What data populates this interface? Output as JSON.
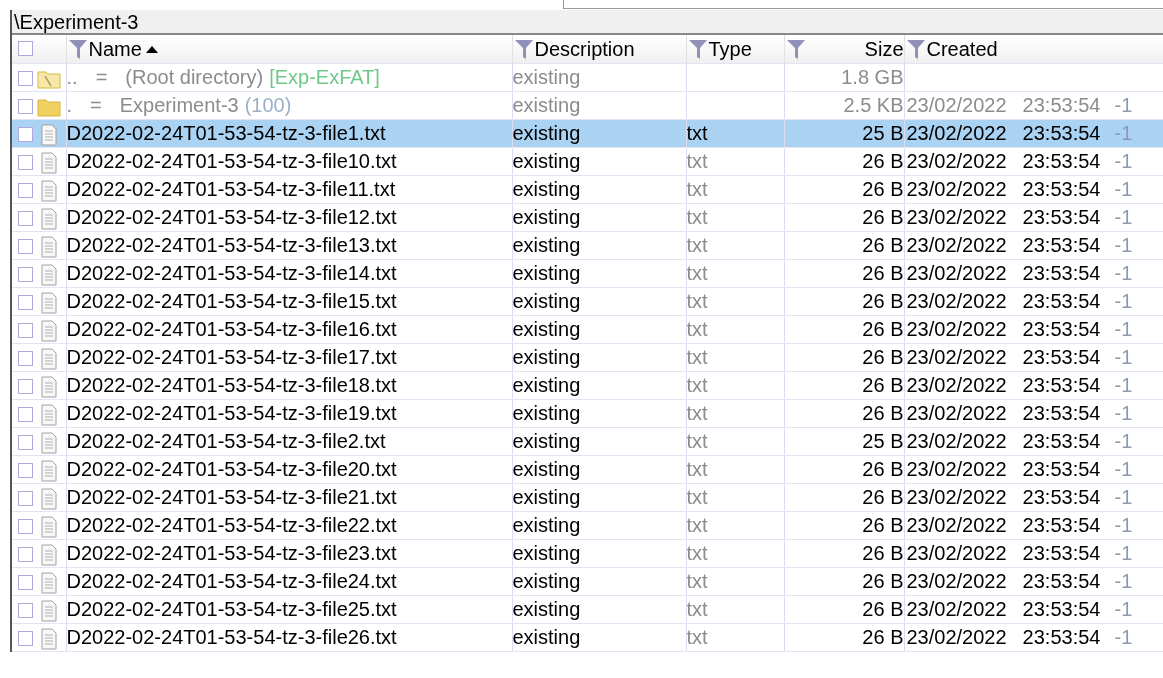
{
  "path": "\\Experiment-3",
  "header_checked": false,
  "columns": [
    {
      "label": "Name",
      "sorted": true
    },
    {
      "label": "Description",
      "sorted": false
    },
    {
      "label": "Type",
      "sorted": false
    },
    {
      "label": "Size",
      "sorted": false
    },
    {
      "label": "Created",
      "sorted": false
    }
  ],
  "rows": [
    {
      "kind": "parent",
      "selected": false,
      "checked": false,
      "name": "..",
      "sign": "=",
      "label": "(Root directory)",
      "extra": "[Exp-ExFAT]",
      "description": "existing",
      "size": "1.8 GB"
    },
    {
      "kind": "current",
      "selected": false,
      "checked": false,
      "name": ".",
      "sign": "=",
      "label": "Experiment-3",
      "extra": "(100)",
      "description": "existing",
      "size": "2.5 KB",
      "date": "23/02/2022",
      "time": "23:53:54",
      "tail": "-1"
    },
    {
      "kind": "file",
      "selected": true,
      "checked": false,
      "name": "D2022-02-24T01-53-54-tz-3-file1.txt",
      "description": "existing",
      "type": "txt",
      "size": "25 B",
      "date": "23/02/2022",
      "time": "23:53:54",
      "tail": "-1"
    },
    {
      "kind": "file",
      "selected": false,
      "checked": false,
      "name": "D2022-02-24T01-53-54-tz-3-file10.txt",
      "description": "existing",
      "type": "txt",
      "size": "26 B",
      "date": "23/02/2022",
      "time": "23:53:54",
      "tail": "-1"
    },
    {
      "kind": "file",
      "selected": false,
      "checked": false,
      "name": "D2022-02-24T01-53-54-tz-3-file11.txt",
      "description": "existing",
      "type": "txt",
      "size": "26 B",
      "date": "23/02/2022",
      "time": "23:53:54",
      "tail": "-1"
    },
    {
      "kind": "file",
      "selected": false,
      "checked": false,
      "name": "D2022-02-24T01-53-54-tz-3-file12.txt",
      "description": "existing",
      "type": "txt",
      "size": "26 B",
      "date": "23/02/2022",
      "time": "23:53:54",
      "tail": "-1"
    },
    {
      "kind": "file",
      "selected": false,
      "checked": false,
      "name": "D2022-02-24T01-53-54-tz-3-file13.txt",
      "description": "existing",
      "type": "txt",
      "size": "26 B",
      "date": "23/02/2022",
      "time": "23:53:54",
      "tail": "-1"
    },
    {
      "kind": "file",
      "selected": false,
      "checked": false,
      "name": "D2022-02-24T01-53-54-tz-3-file14.txt",
      "description": "existing",
      "type": "txt",
      "size": "26 B",
      "date": "23/02/2022",
      "time": "23:53:54",
      "tail": "-1"
    },
    {
      "kind": "file",
      "selected": false,
      "checked": false,
      "name": "D2022-02-24T01-53-54-tz-3-file15.txt",
      "description": "existing",
      "type": "txt",
      "size": "26 B",
      "date": "23/02/2022",
      "time": "23:53:54",
      "tail": "-1"
    },
    {
      "kind": "file",
      "selected": false,
      "checked": false,
      "name": "D2022-02-24T01-53-54-tz-3-file16.txt",
      "description": "existing",
      "type": "txt",
      "size": "26 B",
      "date": "23/02/2022",
      "time": "23:53:54",
      "tail": "-1"
    },
    {
      "kind": "file",
      "selected": false,
      "checked": false,
      "name": "D2022-02-24T01-53-54-tz-3-file17.txt",
      "description": "existing",
      "type": "txt",
      "size": "26 B",
      "date": "23/02/2022",
      "time": "23:53:54",
      "tail": "-1"
    },
    {
      "kind": "file",
      "selected": false,
      "checked": false,
      "name": "D2022-02-24T01-53-54-tz-3-file18.txt",
      "description": "existing",
      "type": "txt",
      "size": "26 B",
      "date": "23/02/2022",
      "time": "23:53:54",
      "tail": "-1"
    },
    {
      "kind": "file",
      "selected": false,
      "checked": false,
      "name": "D2022-02-24T01-53-54-tz-3-file19.txt",
      "description": "existing",
      "type": "txt",
      "size": "26 B",
      "date": "23/02/2022",
      "time": "23:53:54",
      "tail": "-1"
    },
    {
      "kind": "file",
      "selected": false,
      "checked": false,
      "name": "D2022-02-24T01-53-54-tz-3-file2.txt",
      "description": "existing",
      "type": "txt",
      "size": "25 B",
      "date": "23/02/2022",
      "time": "23:53:54",
      "tail": "-1"
    },
    {
      "kind": "file",
      "selected": false,
      "checked": false,
      "name": "D2022-02-24T01-53-54-tz-3-file20.txt",
      "description": "existing",
      "type": "txt",
      "size": "26 B",
      "date": "23/02/2022",
      "time": "23:53:54",
      "tail": "-1"
    },
    {
      "kind": "file",
      "selected": false,
      "checked": false,
      "name": "D2022-02-24T01-53-54-tz-3-file21.txt",
      "description": "existing",
      "type": "txt",
      "size": "26 B",
      "date": "23/02/2022",
      "time": "23:53:54",
      "tail": "-1"
    },
    {
      "kind": "file",
      "selected": false,
      "checked": false,
      "name": "D2022-02-24T01-53-54-tz-3-file22.txt",
      "description": "existing",
      "type": "txt",
      "size": "26 B",
      "date": "23/02/2022",
      "time": "23:53:54",
      "tail": "-1"
    },
    {
      "kind": "file",
      "selected": false,
      "checked": false,
      "name": "D2022-02-24T01-53-54-tz-3-file23.txt",
      "description": "existing",
      "type": "txt",
      "size": "26 B",
      "date": "23/02/2022",
      "time": "23:53:54",
      "tail": "-1"
    },
    {
      "kind": "file",
      "selected": false,
      "checked": false,
      "name": "D2022-02-24T01-53-54-tz-3-file24.txt",
      "description": "existing",
      "type": "txt",
      "size": "26 B",
      "date": "23/02/2022",
      "time": "23:53:54",
      "tail": "-1"
    },
    {
      "kind": "file",
      "selected": false,
      "checked": false,
      "name": "D2022-02-24T01-53-54-tz-3-file25.txt",
      "description": "existing",
      "type": "txt",
      "size": "26 B",
      "date": "23/02/2022",
      "time": "23:53:54",
      "tail": "-1"
    },
    {
      "kind": "file",
      "selected": false,
      "checked": false,
      "name": "D2022-02-24T01-53-54-tz-3-file26.txt",
      "description": "existing",
      "type": "txt",
      "size": "26 B",
      "date": "23/02/2022",
      "time": "23:53:54",
      "tail": "-1"
    }
  ]
}
